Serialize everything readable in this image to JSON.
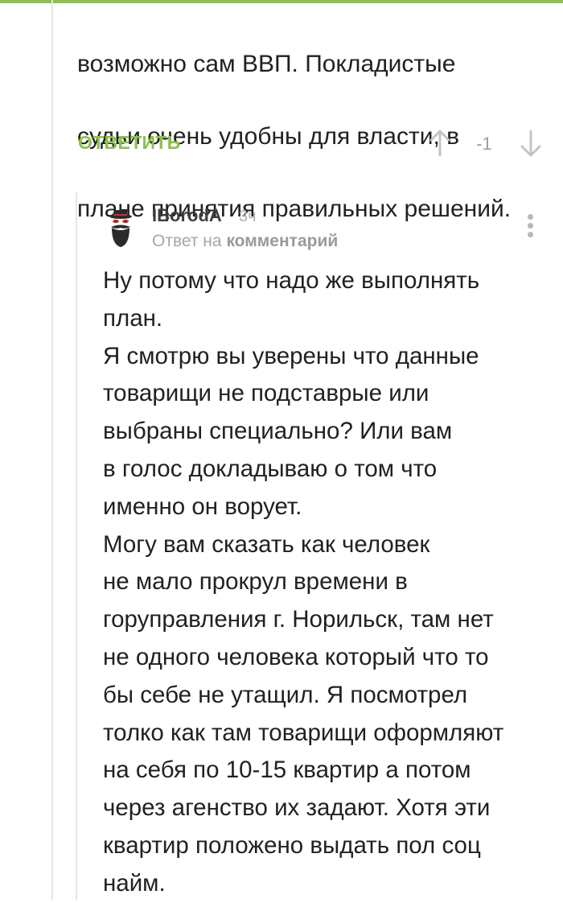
{
  "parent_comment": {
    "text_lines": [
      "возможно сам ВВП. Покладистые",
      "судьи очень удобны для власти, в",
      "плане принятия правильных решений."
    ],
    "reply_label": "ОТВЕТИТЬ",
    "score": "-1",
    "upvote_icon": "arrow-up-icon",
    "downvote_icon": "arrow-down-icon"
  },
  "comment": {
    "author": "IBorodA",
    "time": "3ч",
    "reply_prefix": "Ответ на",
    "reply_target": "комментарий",
    "avatar_icon": "bearded-man-avatar",
    "menu_icon": "more-vertical-icon",
    "text_lines": [
      "Ну потому что надо же выполнять",
      "план.",
      "Я смотрю вы уверены что данные",
      "товарищи не подставрые или",
      "выбраны специально? Или вам",
      "в голос докладываю о том что",
      "именно он ворует.",
      "Могу вам сказать как человек",
      "не мало прокрул времени в",
      "горуправления г. Норильск, там нет",
      "не одного человека который что то",
      "бы себе не утащил. Я посмотрел",
      "толко как там товарищи оформляют",
      "на себя по 10-15 квартир а потом",
      "через агенство их задают. Хотя эти",
      "квартир положено выдать пол соц",
      "найм."
    ]
  },
  "colors": {
    "accent": "#8bc34a",
    "text": "#212121",
    "muted": "#a6a6a6",
    "thread_line": "#e6e6e6"
  }
}
